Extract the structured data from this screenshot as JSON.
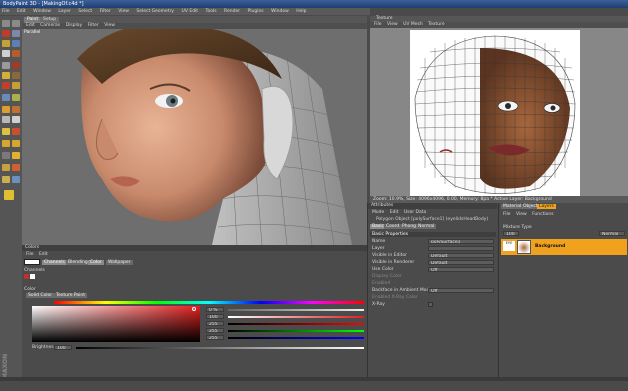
{
  "app": {
    "title": "BodyPaint 3D - [MakingOf.c4d *]"
  },
  "menu": [
    "File",
    "Edit",
    "Window",
    "Layer",
    "Select",
    "Filter",
    "View",
    "Select Geometry",
    "UV Edit",
    "Tools",
    "Render",
    "Plugins",
    "Window",
    "Help"
  ],
  "viewport": {
    "tabs": [
      "Paint",
      "Setup"
    ],
    "menu": [
      "Edit",
      "Cameras",
      "Display",
      "Filter",
      "View"
    ],
    "label": "Parallel"
  },
  "texture_view": {
    "header": "Texture",
    "menu": [
      "File",
      "View",
      "UV Mesh",
      "Texture"
    ],
    "status": "Zoom: 10.9%, Size: 4096x4096, 0.00, Memory: 8pa * Active Layer: Background"
  },
  "colors_panel": {
    "header": "Colors",
    "menu": [
      "File",
      "Edit"
    ],
    "tabs": [
      "Channels",
      "Blending",
      "Color",
      "Wallpaper"
    ],
    "channels_label": "Channels",
    "color_label": "Color",
    "mode_tabs": [
      "Solid Color",
      "Texture Paint"
    ],
    "values": [
      "0 %",
      "100 %",
      "255",
      "255",
      "255"
    ],
    "brightness_label": "Brightness",
    "brightness_value": "100 %"
  },
  "attributes": {
    "header": "Attributes",
    "menu": [
      "Mode",
      "Edit",
      "User Data"
    ],
    "object_line": "Polygon Object [polySurface1] (eyelidsHeadBody)",
    "tabs": [
      "Basic",
      "Coord.",
      "Phong",
      "Normal"
    ],
    "section": "Basic Properties",
    "rows": [
      {
        "label": "Name",
        "value": "polySurface1 (eyelidsHeadBody)"
      },
      {
        "label": "Layer",
        "value": ""
      },
      {
        "label": "Visible in Editor",
        "value": "Default"
      },
      {
        "label": "Visible in Renderer",
        "value": "Default"
      },
      {
        "label": "Use Color",
        "value": "Off"
      },
      {
        "label": "Display Color",
        "value": ""
      },
      {
        "label": "",
        "value": ""
      },
      {
        "label": "Enabled",
        "value": ""
      },
      {
        "label": "Backface in Ambient Mode",
        "value": "Off"
      },
      {
        "label": "Enabled X-Ray Color",
        "value": ""
      },
      {
        "label": "X-Ray",
        "value": ""
      }
    ]
  },
  "layers": {
    "tabs": [
      "Materials",
      "Objects",
      "Layers"
    ],
    "menu": [
      "File",
      "View",
      "Functions"
    ],
    "blend_label": "Mixture Type",
    "opacity": "100 %",
    "mode": "Normal",
    "items": [
      {
        "name": "Background"
      }
    ]
  },
  "colors": {
    "accent": "#f0a21e",
    "title": "#2a4f8a",
    "panel": "#4b4b4b"
  }
}
